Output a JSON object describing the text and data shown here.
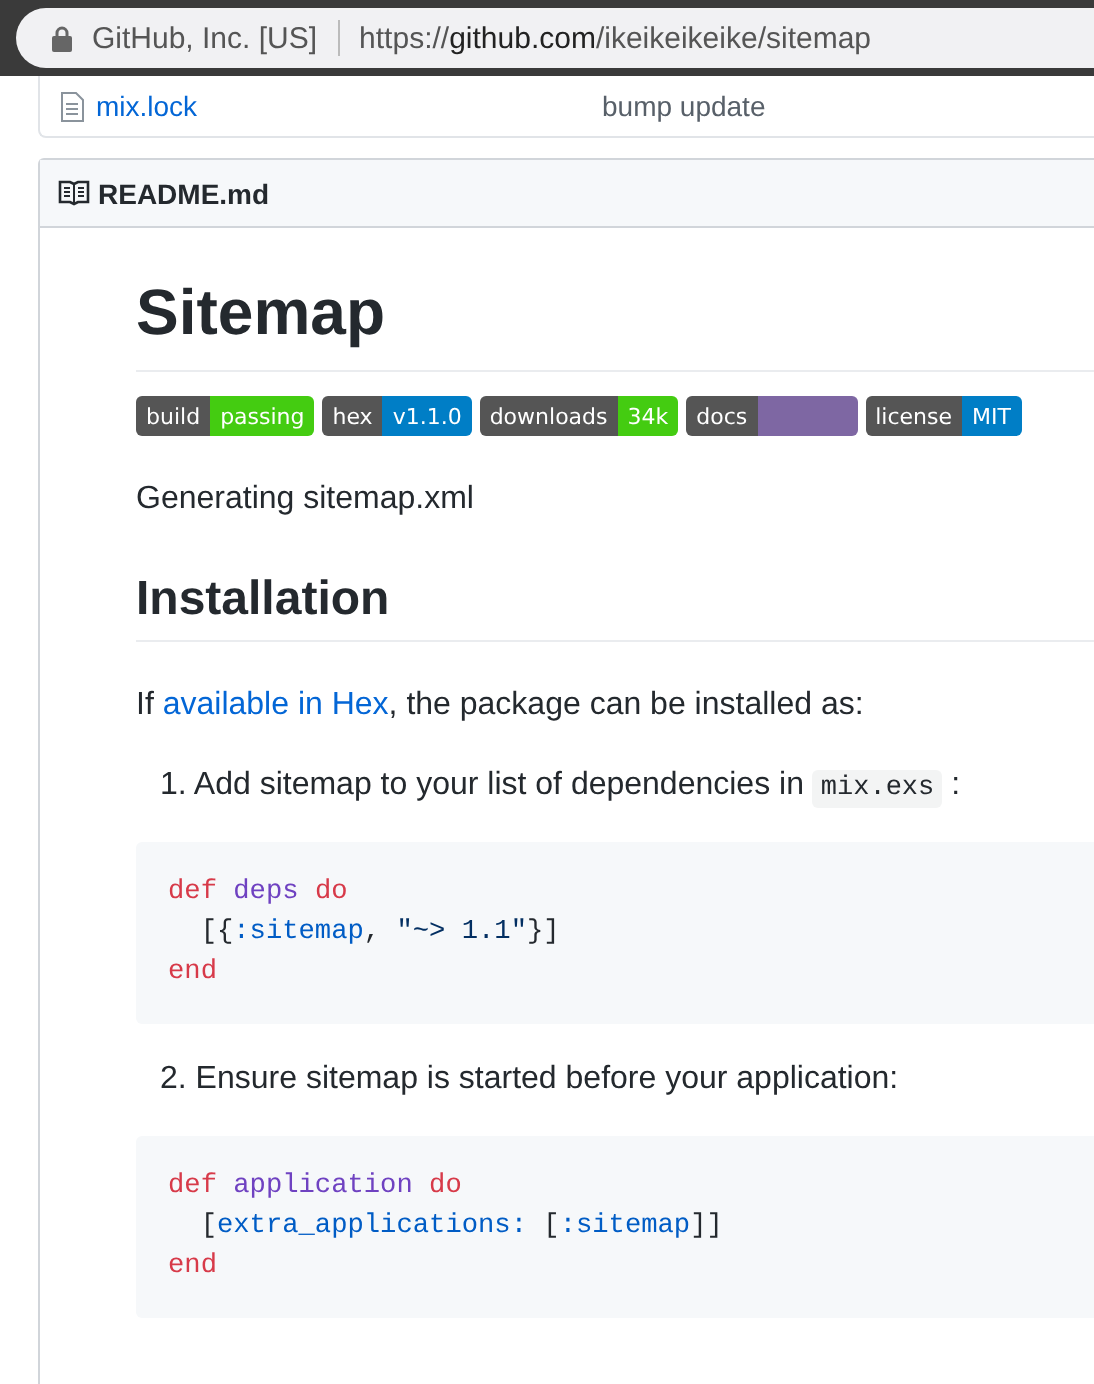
{
  "address_bar": {
    "site_identity": "GitHub, Inc. [US]",
    "url": {
      "scheme": "https://",
      "host": "github.com",
      "path": "/ikeikeikeike/sitemap"
    }
  },
  "file_row": {
    "name": "mix.lock",
    "commit_message": "bump update"
  },
  "readme": {
    "filename": "README.md",
    "title": "Sitemap",
    "badges": [
      {
        "label": "build",
        "value": "passing",
        "color": "#4c1"
      },
      {
        "label": "hex",
        "value": "v1.1.0",
        "color": "#007ec6"
      },
      {
        "label": "downloads",
        "value": "34k",
        "color": "#4c1"
      },
      {
        "label": "docs",
        "color": "#7e67a3"
      },
      {
        "label": "license",
        "value": "MIT",
        "color": "#007ec6"
      }
    ],
    "description": "Generating sitemap.xml",
    "section_heading": "Installation",
    "intro": {
      "before": "If ",
      "link": "available in Hex",
      "after": ", the package can be installed as:"
    },
    "steps": [
      {
        "number": "1.",
        "text": "Add sitemap to your list of dependencies in ",
        "code": "mix.exs",
        "after": ":",
        "snippet": [
          [
            {
              "kind": "keyword",
              "text": "def "
            },
            {
              "kind": "function",
              "text": "deps "
            },
            {
              "kind": "keyword",
              "text": "do"
            }
          ],
          [
            {
              "kind": "plain",
              "text": "  [{"
            },
            {
              "kind": "symbol",
              "text": ":sitemap"
            },
            {
              "kind": "plain",
              "text": ", "
            },
            {
              "kind": "string",
              "text": "\"~> 1.1\""
            },
            {
              "kind": "plain",
              "text": "}]"
            }
          ],
          [
            {
              "kind": "keyword",
              "text": "end"
            }
          ]
        ]
      },
      {
        "number": "2.",
        "text": "Ensure sitemap is started before your application:",
        "snippet": [
          [
            {
              "kind": "keyword",
              "text": "def "
            },
            {
              "kind": "function",
              "text": "application "
            },
            {
              "kind": "keyword",
              "text": "do"
            }
          ],
          [
            {
              "kind": "plain",
              "text": "  ["
            },
            {
              "kind": "symbol",
              "text": "extra_applications:"
            },
            {
              "kind": "plain",
              "text": " ["
            },
            {
              "kind": "symbol",
              "text": ":sitemap"
            },
            {
              "kind": "plain",
              "text": "]]"
            }
          ],
          [
            {
              "kind": "keyword",
              "text": "end"
            }
          ]
        ]
      }
    ]
  }
}
